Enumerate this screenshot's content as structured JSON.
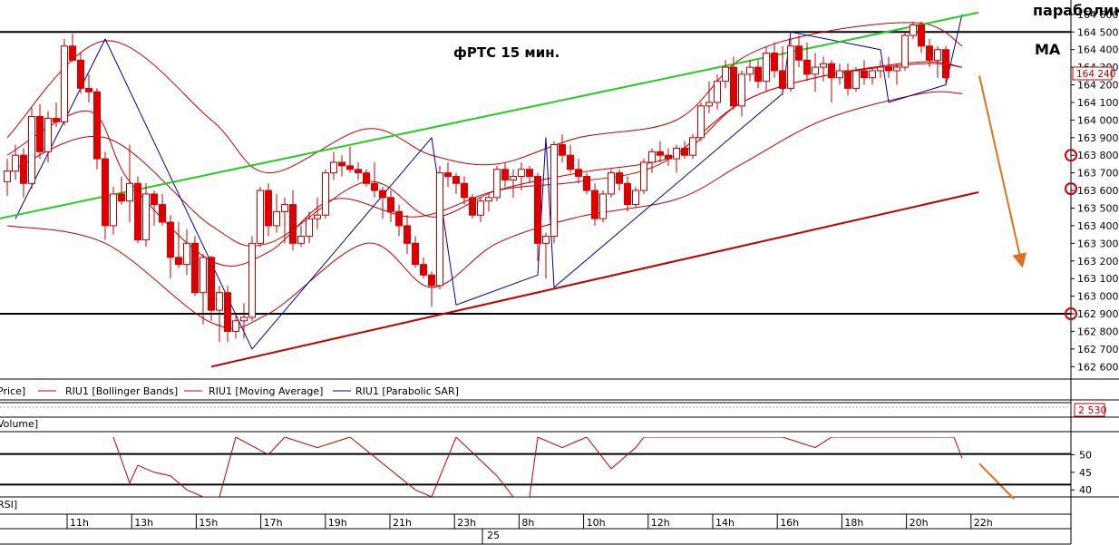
{
  "chart_data": {
    "type": "candlestick",
    "instrument": "RIU1",
    "title": "фРТС   15 мин.",
    "annotations": {
      "parabolic": "параболик",
      "ma": "MA"
    },
    "price_axis": {
      "range": [
        162550,
        164630
      ],
      "ticks": [
        164600,
        164500,
        164400,
        164300,
        164200,
        164100,
        164000,
        163900,
        163800,
        163700,
        163600,
        163500,
        163400,
        163300,
        163200,
        163100,
        163000,
        162900,
        162800,
        162700,
        162600
      ],
      "tick_labels": [
        "164 600",
        "164 500",
        "164 400",
        "164 300",
        "164 200",
        "164 100",
        "164 000",
        "163 900",
        "163 800",
        "163 700",
        "163 600",
        "163 500",
        "163 400",
        "163 300",
        "163 200",
        "163 100",
        "163 000",
        "162 900",
        "162 800",
        "162 700",
        "162 600"
      ],
      "current_price": 164240,
      "current_price_label": "164 240",
      "horizontal_levels": [
        164500,
        162900
      ]
    },
    "legend": [
      {
        "label": "Price]",
        "color": "#c00000"
      },
      {
        "label": "RIU1 [Bollinger Bands]",
        "color": "#c00000"
      },
      {
        "label": "RIU1 [Moving Average]",
        "color": "#c00000"
      },
      {
        "label": "RIU1 [Parabolic SAR]",
        "color": "#000099"
      }
    ],
    "volume_pane": {
      "label": "Volume]",
      "last_value_label": "2 530"
    },
    "rsi_pane": {
      "label": "RSI]",
      "range": [
        38,
        55
      ],
      "ticks": [
        50,
        45,
        40
      ],
      "tick_labels": [
        "50",
        "45",
        "40"
      ],
      "levels": [
        50.2,
        41.5
      ]
    },
    "time_axis": {
      "labels": [
        "11h",
        "13h",
        "15h",
        "17h",
        "19h",
        "21h",
        "23h",
        "8h",
        "10h",
        "12h",
        "14h",
        "16h",
        "18h",
        "20h",
        "22h"
      ],
      "date_label": "25"
    },
    "candles": [
      {
        "o": 163650,
        "h": 163780,
        "l": 163570,
        "c": 163710
      },
      {
        "o": 163710,
        "h": 163860,
        "l": 163660,
        "c": 163800
      },
      {
        "o": 163800,
        "h": 163840,
        "l": 163560,
        "c": 163640
      },
      {
        "o": 163640,
        "h": 164070,
        "l": 163610,
        "c": 164020
      },
      {
        "o": 164020,
        "h": 164090,
        "l": 163780,
        "c": 163820
      },
      {
        "o": 163820,
        "h": 164050,
        "l": 163760,
        "c": 164010
      },
      {
        "o": 164010,
        "h": 164100,
        "l": 163960,
        "c": 163990
      },
      {
        "o": 163990,
        "h": 164460,
        "l": 163970,
        "c": 164420
      },
      {
        "o": 164420,
        "h": 164490,
        "l": 164330,
        "c": 164340
      },
      {
        "o": 164340,
        "h": 164380,
        "l": 164150,
        "c": 164180
      },
      {
        "o": 164180,
        "h": 164260,
        "l": 164100,
        "c": 164160
      },
      {
        "o": 164160,
        "h": 164180,
        "l": 163720,
        "c": 163780
      },
      {
        "o": 163780,
        "h": 163820,
        "l": 163320,
        "c": 163400
      },
      {
        "o": 163400,
        "h": 163620,
        "l": 163350,
        "c": 163580
      },
      {
        "o": 163580,
        "h": 163680,
        "l": 163520,
        "c": 163540
      },
      {
        "o": 163540,
        "h": 163860,
        "l": 163420,
        "c": 163640
      },
      {
        "o": 163640,
        "h": 163680,
        "l": 163300,
        "c": 163320
      },
      {
        "o": 163320,
        "h": 163640,
        "l": 163280,
        "c": 163580
      },
      {
        "o": 163580,
        "h": 163600,
        "l": 163400,
        "c": 163520
      },
      {
        "o": 163520,
        "h": 163580,
        "l": 163400,
        "c": 163420
      },
      {
        "o": 163420,
        "h": 163460,
        "l": 163100,
        "c": 163220
      },
      {
        "o": 163220,
        "h": 163420,
        "l": 163160,
        "c": 163180
      },
      {
        "o": 163180,
        "h": 163380,
        "l": 163120,
        "c": 163300
      },
      {
        "o": 163300,
        "h": 163340,
        "l": 163000,
        "c": 163020
      },
      {
        "o": 163020,
        "h": 163240,
        "l": 162840,
        "c": 163220
      },
      {
        "o": 163220,
        "h": 163230,
        "l": 162860,
        "c": 162920
      },
      {
        "o": 162920,
        "h": 163060,
        "l": 162740,
        "c": 163020
      },
      {
        "o": 163020,
        "h": 163060,
        "l": 162740,
        "c": 162800
      },
      {
        "o": 162800,
        "h": 162900,
        "l": 162760,
        "c": 162860
      },
      {
        "o": 162860,
        "h": 162960,
        "l": 162760,
        "c": 162880
      },
      {
        "o": 162880,
        "h": 163340,
        "l": 162860,
        "c": 163300
      },
      {
        "o": 163300,
        "h": 163620,
        "l": 163280,
        "c": 163600
      },
      {
        "o": 163600,
        "h": 163640,
        "l": 163340,
        "c": 163400
      },
      {
        "o": 163400,
        "h": 163580,
        "l": 163360,
        "c": 163480
      },
      {
        "o": 163480,
        "h": 163560,
        "l": 163300,
        "c": 163520
      },
      {
        "o": 163520,
        "h": 163600,
        "l": 163260,
        "c": 163300
      },
      {
        "o": 163300,
        "h": 163400,
        "l": 163280,
        "c": 163340
      },
      {
        "o": 163340,
        "h": 163480,
        "l": 163300,
        "c": 163440
      },
      {
        "o": 163440,
        "h": 163560,
        "l": 163380,
        "c": 163460
      },
      {
        "o": 163460,
        "h": 163720,
        "l": 163440,
        "c": 163700
      },
      {
        "o": 163700,
        "h": 163820,
        "l": 163660,
        "c": 163760
      },
      {
        "o": 163760,
        "h": 163800,
        "l": 163680,
        "c": 163740
      },
      {
        "o": 163740,
        "h": 163850,
        "l": 163700,
        "c": 163720
      },
      {
        "o": 163720,
        "h": 163760,
        "l": 163660,
        "c": 163700
      },
      {
        "o": 163700,
        "h": 163720,
        "l": 163620,
        "c": 163640
      },
      {
        "o": 163640,
        "h": 163760,
        "l": 163560,
        "c": 163600
      },
      {
        "o": 163600,
        "h": 163620,
        "l": 163440,
        "c": 163560
      },
      {
        "o": 163560,
        "h": 163600,
        "l": 163420,
        "c": 163480
      },
      {
        "o": 163480,
        "h": 163520,
        "l": 163340,
        "c": 163400
      },
      {
        "o": 163400,
        "h": 163460,
        "l": 163240,
        "c": 163300
      },
      {
        "o": 163300,
        "h": 163340,
        "l": 163160,
        "c": 163180
      },
      {
        "o": 163180,
        "h": 163220,
        "l": 163100,
        "c": 163120
      },
      {
        "o": 163120,
        "h": 163140,
        "l": 162940,
        "c": 163060
      },
      {
        "o": 163060,
        "h": 163740,
        "l": 163040,
        "c": 163700
      },
      {
        "o": 163700,
        "h": 163760,
        "l": 163620,
        "c": 163680
      },
      {
        "o": 163680,
        "h": 163700,
        "l": 163580,
        "c": 163640
      },
      {
        "o": 163640,
        "h": 163680,
        "l": 163520,
        "c": 163560
      },
      {
        "o": 163560,
        "h": 163580,
        "l": 163440,
        "c": 163460
      },
      {
        "o": 163460,
        "h": 163560,
        "l": 163420,
        "c": 163540
      },
      {
        "o": 163540,
        "h": 163580,
        "l": 163480,
        "c": 163560
      },
      {
        "o": 163560,
        "h": 163740,
        "l": 163540,
        "c": 163720
      },
      {
        "o": 163720,
        "h": 163760,
        "l": 163620,
        "c": 163660
      },
      {
        "o": 163660,
        "h": 163720,
        "l": 163560,
        "c": 163680
      },
      {
        "o": 163680,
        "h": 163760,
        "l": 163600,
        "c": 163720
      },
      {
        "o": 163720,
        "h": 163740,
        "l": 163640,
        "c": 163680
      },
      {
        "o": 163680,
        "h": 163700,
        "l": 163200,
        "c": 163300
      },
      {
        "o": 163300,
        "h": 163360,
        "l": 163100,
        "c": 163340
      },
      {
        "o": 163340,
        "h": 163880,
        "l": 163300,
        "c": 163860
      },
      {
        "o": 163860,
        "h": 163920,
        "l": 163760,
        "c": 163800
      },
      {
        "o": 163800,
        "h": 163860,
        "l": 163700,
        "c": 163720
      },
      {
        "o": 163720,
        "h": 163780,
        "l": 163640,
        "c": 163680
      },
      {
        "o": 163680,
        "h": 163700,
        "l": 163580,
        "c": 163600
      },
      {
        "o": 163600,
        "h": 163640,
        "l": 163400,
        "c": 163440
      },
      {
        "o": 163440,
        "h": 163600,
        "l": 163420,
        "c": 163580
      },
      {
        "o": 163580,
        "h": 163720,
        "l": 163560,
        "c": 163700
      },
      {
        "o": 163700,
        "h": 163720,
        "l": 163600,
        "c": 163640
      },
      {
        "o": 163640,
        "h": 163680,
        "l": 163480,
        "c": 163520
      },
      {
        "o": 163520,
        "h": 163620,
        "l": 163500,
        "c": 163600
      },
      {
        "o": 163600,
        "h": 163780,
        "l": 163580,
        "c": 163760
      },
      {
        "o": 163760,
        "h": 163840,
        "l": 163700,
        "c": 163820
      },
      {
        "o": 163820,
        "h": 163880,
        "l": 163760,
        "c": 163800
      },
      {
        "o": 163800,
        "h": 163840,
        "l": 163740,
        "c": 163780
      },
      {
        "o": 163780,
        "h": 163860,
        "l": 163700,
        "c": 163840
      },
      {
        "o": 163840,
        "h": 163880,
        "l": 163780,
        "c": 163800
      },
      {
        "o": 163800,
        "h": 163920,
        "l": 163780,
        "c": 163900
      },
      {
        "o": 163900,
        "h": 164100,
        "l": 163880,
        "c": 164080
      },
      {
        "o": 164080,
        "h": 164220,
        "l": 164040,
        "c": 164100
      },
      {
        "o": 164100,
        "h": 164260,
        "l": 164060,
        "c": 164220
      },
      {
        "o": 164220,
        "h": 164340,
        "l": 164180,
        "c": 164300
      },
      {
        "o": 164300,
        "h": 164360,
        "l": 164060,
        "c": 164080
      },
      {
        "o": 164080,
        "h": 164280,
        "l": 164020,
        "c": 164260
      },
      {
        "o": 164260,
        "h": 164340,
        "l": 164220,
        "c": 164300
      },
      {
        "o": 164300,
        "h": 164340,
        "l": 164180,
        "c": 164220
      },
      {
        "o": 164220,
        "h": 164420,
        "l": 164160,
        "c": 164380
      },
      {
        "o": 164380,
        "h": 164440,
        "l": 164240,
        "c": 164280
      },
      {
        "o": 164280,
        "h": 164420,
        "l": 164140,
        "c": 164180
      },
      {
        "o": 164180,
        "h": 164460,
        "l": 164160,
        "c": 164420
      },
      {
        "o": 164420,
        "h": 164480,
        "l": 164300,
        "c": 164340
      },
      {
        "o": 164340,
        "h": 164440,
        "l": 164220,
        "c": 164260
      },
      {
        "o": 164260,
        "h": 164380,
        "l": 164160,
        "c": 164300
      },
      {
        "o": 164300,
        "h": 164360,
        "l": 164220,
        "c": 164320
      },
      {
        "o": 164320,
        "h": 164340,
        "l": 164100,
        "c": 164240
      },
      {
        "o": 164240,
        "h": 164320,
        "l": 164200,
        "c": 164280
      },
      {
        "o": 164280,
        "h": 164320,
        "l": 164140,
        "c": 164180
      },
      {
        "o": 164180,
        "h": 164300,
        "l": 164160,
        "c": 164280
      },
      {
        "o": 164280,
        "h": 164340,
        "l": 164200,
        "c": 164240
      },
      {
        "o": 164240,
        "h": 164300,
        "l": 164200,
        "c": 164280
      },
      {
        "o": 164280,
        "h": 164340,
        "l": 164240,
        "c": 164300
      },
      {
        "o": 164300,
        "h": 164360,
        "l": 164240,
        "c": 164280
      },
      {
        "o": 164280,
        "h": 164320,
        "l": 164200,
        "c": 164300
      },
      {
        "o": 164300,
        "h": 164500,
        "l": 164280,
        "c": 164480
      },
      {
        "o": 164480,
        "h": 164560,
        "l": 164460,
        "c": 164540
      },
      {
        "o": 164540,
        "h": 164560,
        "l": 164380,
        "c": 164420
      },
      {
        "o": 164420,
        "h": 164460,
        "l": 164300,
        "c": 164340
      },
      {
        "o": 164340,
        "h": 164420,
        "l": 164240,
        "c": 164400
      },
      {
        "o": 164400,
        "h": 164420,
        "l": 164200,
        "c": 164240
      }
    ],
    "bollinger": {
      "upper": [
        [
          0,
          163900
        ],
        [
          12,
          164450
        ],
        [
          25,
          164000
        ],
        [
          32,
          163700
        ],
        [
          44,
          163950
        ],
        [
          52,
          163800
        ],
        [
          60,
          163750
        ],
        [
          70,
          163900
        ],
        [
          82,
          164000
        ],
        [
          90,
          164350
        ],
        [
          100,
          164500
        ],
        [
          112,
          164550
        ],
        [
          117,
          164420
        ]
      ],
      "middle": [
        [
          0,
          163700
        ],
        [
          12,
          163900
        ],
        [
          25,
          163400
        ],
        [
          32,
          163300
        ],
        [
          44,
          163650
        ],
        [
          52,
          163450
        ],
        [
          60,
          163600
        ],
        [
          70,
          163700
        ],
        [
          82,
          163800
        ],
        [
          90,
          164100
        ],
        [
          100,
          164250
        ],
        [
          112,
          164320
        ],
        [
          117,
          164300
        ]
      ],
      "lower": [
        [
          0,
          163400
        ],
        [
          12,
          163300
        ],
        [
          25,
          162850
        ],
        [
          32,
          162900
        ],
        [
          44,
          163300
        ],
        [
          52,
          163050
        ],
        [
          60,
          163300
        ],
        [
          70,
          163450
        ],
        [
          82,
          163550
        ],
        [
          90,
          163750
        ],
        [
          100,
          164000
        ],
        [
          112,
          164150
        ],
        [
          117,
          164150
        ]
      ]
    },
    "moving_average": [
      [
        0,
        163800
      ],
      [
        10,
        164050
      ],
      [
        15,
        163650
      ],
      [
        25,
        163200
      ],
      [
        32,
        163250
      ],
      [
        40,
        163550
      ],
      [
        50,
        163450
      ],
      [
        60,
        163600
      ],
      [
        70,
        163650
      ],
      [
        80,
        163750
      ],
      [
        90,
        164100
      ],
      [
        100,
        164250
      ],
      [
        112,
        164330
      ],
      [
        117,
        164300
      ]
    ],
    "parabolic_sar": [
      [
        1,
        163440
      ],
      [
        12,
        164460
      ],
      [
        30,
        162700
      ],
      [
        52,
        163900
      ],
      [
        55,
        162950
      ],
      [
        65,
        163120
      ],
      [
        66,
        163900
      ],
      [
        67,
        163050
      ],
      [
        95,
        164150
      ],
      [
        96,
        164500
      ],
      [
        107,
        164400
      ],
      [
        108,
        164100
      ],
      [
        115,
        164200
      ],
      [
        117,
        164600
      ]
    ],
    "trendlines": [
      {
        "name": "green",
        "color": "#22cc22",
        "points": [
          [
            -1,
            163440
          ],
          [
            119,
            164610
          ]
        ]
      },
      {
        "name": "red",
        "color": "#c00000",
        "points": [
          [
            25,
            162600
          ],
          [
            119,
            163590
          ]
        ]
      }
    ],
    "rsi_series": [
      [
        13,
        55
      ],
      [
        15,
        42
      ],
      [
        16,
        47
      ],
      [
        18,
        45
      ],
      [
        20,
        44
      ],
      [
        22,
        40
      ],
      [
        24,
        38
      ],
      [
        26,
        38
      ],
      [
        28,
        55
      ],
      [
        32,
        50
      ],
      [
        34,
        55
      ],
      [
        38,
        52
      ],
      [
        42,
        55
      ],
      [
        50,
        40
      ],
      [
        52,
        38
      ],
      [
        55,
        55
      ],
      [
        60,
        44
      ],
      [
        62,
        38
      ],
      [
        64,
        38
      ],
      [
        65,
        55
      ],
      [
        68,
        52
      ],
      [
        71,
        55
      ],
      [
        74,
        46
      ],
      [
        77,
        52
      ],
      [
        78,
        55
      ],
      [
        95,
        55
      ],
      [
        99,
        52
      ],
      [
        101,
        55
      ],
      [
        116,
        55
      ],
      [
        117,
        49
      ]
    ],
    "forecast_arrows": [
      {
        "from": [
          118,
          164200
        ],
        "to": [
          124,
          163200
        ]
      },
      {
        "from": [
          118,
          49
        ],
        "to": [
          124,
          38
        ]
      }
    ]
  }
}
